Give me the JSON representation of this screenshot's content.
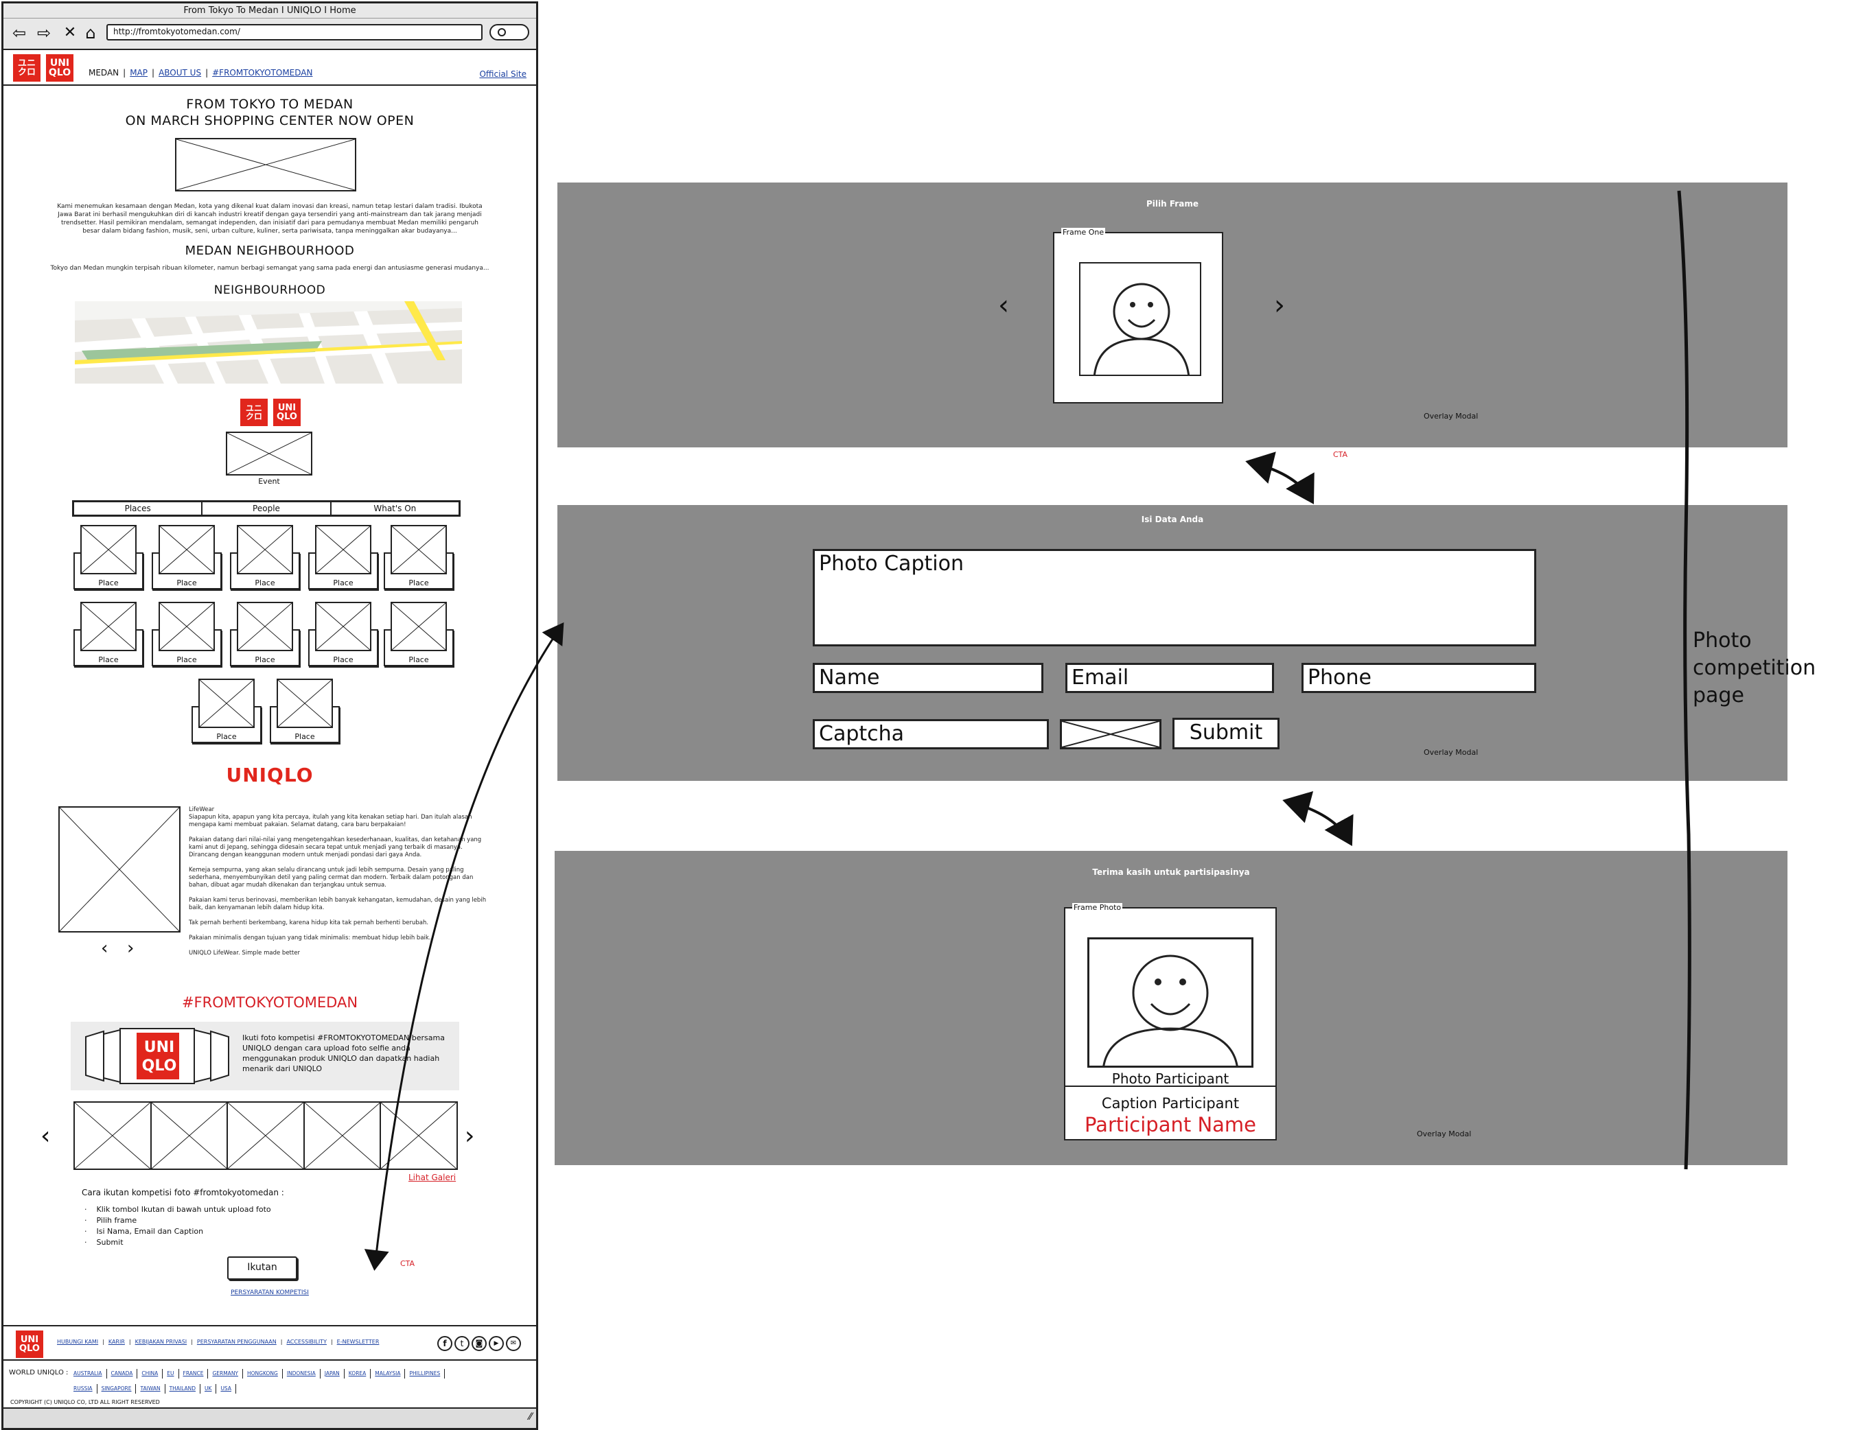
{
  "browser": {
    "title": "From Tokyo To Medan I UNIQLO I Home",
    "url": "http://fromtokyotomedan.com/"
  },
  "header": {
    "logo_text": "UNI QLO",
    "nav": [
      "MEDAN",
      "MAP",
      "ABOUT US",
      "#FROMTOKYOTOMEDAN"
    ],
    "official_site": "Official Site"
  },
  "hero": {
    "title_line1": "FROM TOKYO TO MEDAN",
    "title_line2": "ON MARCH SHOPPING CENTER NOW OPEN",
    "intro": "Kami menemukan kesamaan dengan Medan, kota yang dikenal kuat dalam inovasi dan kreasi, namun tetap lestari dalam tradisi. Ibukota Jawa Barat ini berhasil mengukuhkan diri di kancah industri kreatif dengan gaya tersendiri yang anti-mainstream dan tak jarang menjadi trendsetter. Hasil pemikiran mendalam, semangat independen, dan inisiatif dari para pemudanya membuat Medan memiliki pengaruh besar dalam bidang fashion, musik, seni, urban culture, kuliner, serta pariwisata, tanpa meninggalkan akar budayanya..."
  },
  "neighbourhood": {
    "title": "MEDAN NEIGHBOURHOOD",
    "text": "Tokyo dan Medan mungkin terpisah ribuan kilometer, namun berbagi semangat yang sama pada energi dan antusiasme generasi mudanya...",
    "map_title": "NEIGHBOURHOOD",
    "event_label": "Event"
  },
  "tabs": [
    "Places",
    "People",
    "What's On"
  ],
  "places": [
    "Place",
    "Place",
    "Place",
    "Place",
    "Place",
    "Place",
    "Place",
    "Place",
    "Place",
    "Place",
    "Place",
    "Place"
  ],
  "lifewear": {
    "brand": "UNIQLO",
    "heading": "LifeWear",
    "p1": "Siapapun kita, apapun yang kita percaya, itulah yang kita kenakan setiap hari. Dan itulah alasan mengapa kami membuat pakaian. Selamat datang, cara baru berpakaian!",
    "p2": "Pakaian datang dari nilai-nilai yang mengetengahkan kesederhanaan, kualitas, dan ketahanan yang kami anut di Jepang, sehingga didesain secara tepat untuk menjadi yang terbaik di masanya. Dirancang dengan keanggunan modern untuk menjadi pondasi dari gaya Anda.",
    "p3": "Kemeja sempurna, yang akan selalu dirancang untuk jadi lebih sempurna. Desain yang paling sederhana, menyembunyikan detil yang paling cermat dan modern. Terbaik dalam potongan dan bahan, dibuat agar mudah dikenakan dan terjangkau untuk semua.",
    "p4": "Pakaian kami terus berinovasi, memberikan lebih banyak kehangatan, kemudahan, desain yang lebih baik, dan kenyamanan lebih dalam hidup kita.",
    "p5": "Tak pernah berhenti berkembang, karena hidup kita tak pernah berhenti berubah.",
    "p6": "Pakaian minimalis dengan tujuan yang tidak minimalis: membuat hidup lebih baik.",
    "p7": "UNIQLO LifeWear. Simple made better"
  },
  "competition": {
    "title": "#FROMTOKYOTOMEDAN",
    "promo": "Ikuti foto kompetisi #FROMTOKYOTOMEDAN bersama UNIQLO dengan cara upload foto selfie anda menggunakan produk UNIQLO dan dapatkan hadiah menarik dari UNIQLO",
    "gallery_link": "Lihat Galeri",
    "steps_title": "Cara ikutan kompetisi foto #fromtokyotomedan :",
    "steps": [
      "Klik tombol Ikutan di bawah untuk upload foto",
      "Pilih frame",
      "Isi Nama, Email dan Caption",
      "Submit"
    ],
    "cta_button": "Ikutan",
    "terms_link": "PERSYARATAN KOMPETISI",
    "cta_note": "CTA"
  },
  "footer": {
    "links": [
      "HUBUNGI KAMI",
      "KARIR",
      "KEBIJAKAN PRIVASI",
      "PERSYARATAN PENGGUNAAN",
      "ACCESSIBILITY",
      "E-NEWSLETTER"
    ],
    "world_label": "WORLD UNIQLO :",
    "countries": [
      "AUSTRALIA",
      "CANADA",
      "CHINA",
      "EU",
      "FRANCE",
      "GERMANY",
      "HONGKONG",
      "INDONESIA",
      "JAPAN",
      "KOREA",
      "MALAYSIA",
      "PHILLIPINES",
      "RUSSIA",
      "SINGAPORE",
      "TAIWAN",
      "THAILAND",
      "UK",
      "USA"
    ],
    "copyright": "COPYRIGHT (C) UNIQLO CO, LTD ALL RIGHT RESERVED"
  },
  "modal1": {
    "title": "Pilih Frame",
    "frame_label": "Frame One",
    "overlay": "Overlay Modal",
    "cta": "CTA"
  },
  "modal2": {
    "title": "Isi Data Anda",
    "caption_placeholder": "Photo Caption",
    "name_placeholder": "Name",
    "email_placeholder": "Email",
    "phone_placeholder": "Phone",
    "captcha_placeholder": "Captcha",
    "submit": "Submit",
    "overlay": "Overlay Modal"
  },
  "modal3": {
    "title": "Terima kasih untuk partisipasinya",
    "frame_label": "Frame Photo",
    "photo_label": "Photo Participant",
    "caption": "Caption Participant",
    "participant_name": "Participant Name",
    "overlay": "Overlay Modal"
  },
  "side_note": "Photo competition page",
  "colors": {
    "brand_red": "#e1261c",
    "modal_grey": "#8a8a8a",
    "link_blue": "#1a3fa0"
  }
}
